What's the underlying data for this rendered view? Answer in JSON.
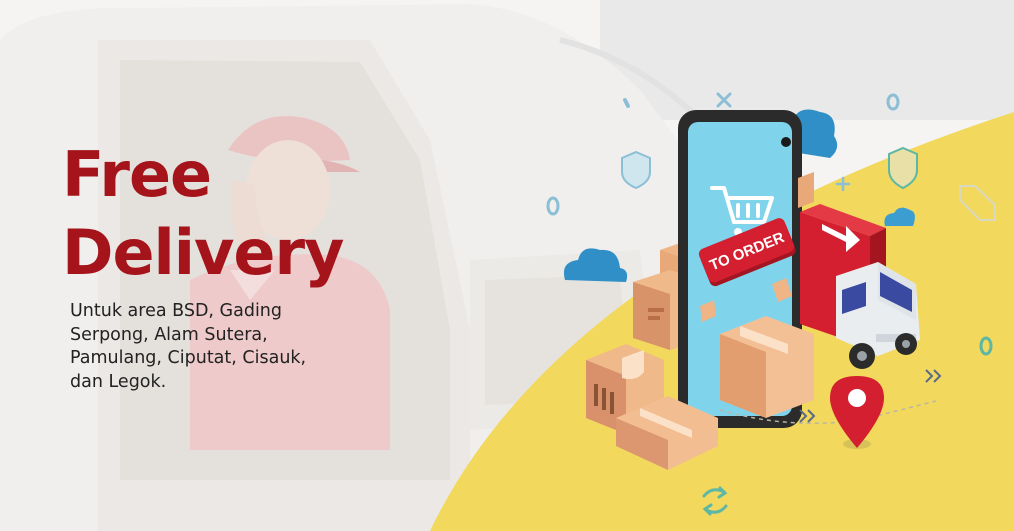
{
  "banner": {
    "headline_line1": "Free",
    "headline_line2": "Delivery",
    "description": "Untuk area BSD, Gading Serpong, Alam Sutera, Pamulang, Ciputat, Cisauk, dan Legok.",
    "button_text": "TO ORDER"
  },
  "colors": {
    "headline": "#a5141a",
    "accent_yellow": "#f2d85c",
    "phone_screen": "#7fd4ec",
    "order_button": "#d31f2f",
    "truck_red": "#d31f2f",
    "box_brown": "#e8a878",
    "cloud_blue": "#2f8fc6"
  },
  "icons": [
    "cart-icon",
    "location-pin-icon",
    "cloud-icon",
    "shield-icon",
    "box-icon",
    "delivery-truck-icon",
    "refresh-icon"
  ]
}
